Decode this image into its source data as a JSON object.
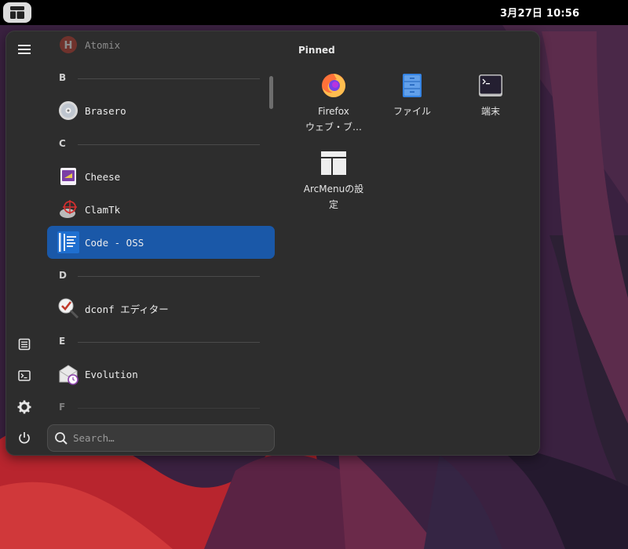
{
  "topbar": {
    "clock": "3月27日  10:56",
    "arcmenu_button_icon": "arcmenu-layout-icon"
  },
  "sidebar": {
    "items": [
      {
        "name": "menu",
        "icon": "hamburger-icon"
      },
      {
        "name": "documents",
        "icon": "document-icon"
      },
      {
        "name": "terminal",
        "icon": "terminal-icon"
      },
      {
        "name": "settings",
        "icon": "gear-icon"
      },
      {
        "name": "power",
        "icon": "power-icon"
      }
    ]
  },
  "app_list": {
    "sections": [
      {
        "letter": "",
        "apps": [
          {
            "label": "Atomix",
            "icon": "atomix-icon"
          }
        ]
      },
      {
        "letter": "B",
        "apps": [
          {
            "label": "Brasero",
            "icon": "disc-icon"
          }
        ]
      },
      {
        "letter": "C",
        "apps": [
          {
            "label": "Cheese",
            "icon": "cheese-icon"
          },
          {
            "label": "ClamTk",
            "icon": "clamtk-icon"
          },
          {
            "label": "Code - OSS",
            "icon": "code-oss-icon",
            "selected": true
          }
        ]
      },
      {
        "letter": "D",
        "apps": [
          {
            "label": "dconf エディター",
            "icon": "dconf-icon"
          }
        ]
      },
      {
        "letter": "E",
        "apps": [
          {
            "label": "Evolution",
            "icon": "evolution-icon"
          }
        ]
      },
      {
        "letter": "F",
        "apps": []
      }
    ]
  },
  "search": {
    "placeholder": "Search…",
    "value": ""
  },
  "pinned": {
    "title": "Pinned",
    "items": [
      {
        "label": "Firefox\nウェブ・ブ…",
        "icon": "firefox-icon"
      },
      {
        "label": "ファイル",
        "icon": "files-icon"
      },
      {
        "label": "端末",
        "icon": "terminal-app-icon"
      },
      {
        "label": "ArcMenuの設\n定",
        "icon": "arcmenu-settings-icon"
      }
    ]
  },
  "colors": {
    "accent": "#1a58a8",
    "menu_bg": "#2d2d2d",
    "topbar_bg": "#000000"
  }
}
